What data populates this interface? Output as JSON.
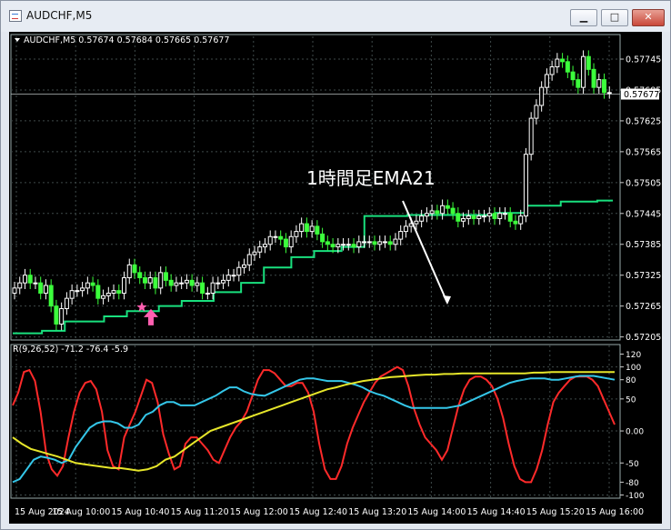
{
  "window": {
    "title": "AUDCHF,M5",
    "buttons": {
      "minimize": "▁",
      "maximize": "□",
      "close": "✕"
    }
  },
  "chart_data": [
    {
      "type": "candlestick",
      "header": "AUDCHF,M5  0.57674 0.57684 0.57665 0.57677",
      "current_price_label": "0.57677",
      "current_price": 0.57677,
      "y_ticks": [
        "0.57745",
        "0.57685",
        "0.57625",
        "0.57565",
        "0.57505",
        "0.57445",
        "0.57385",
        "0.57325",
        "0.57265",
        "0.57205"
      ],
      "ylim": [
        0.57199,
        0.57768
      ],
      "grid": true,
      "annotation": "1時間足EMA21",
      "colors": {
        "bull": "#ffffff",
        "bear": "#3cff3c",
        "ema": "#19e07e",
        "arrow": "#ff5fb0",
        "grid": "#3f4a4a"
      },
      "candle_closes": [
        0.573,
        0.5731,
        0.57325,
        0.5731,
        0.5731,
        0.5729,
        0.57305,
        0.57265,
        0.5723,
        0.5726,
        0.5728,
        0.57295,
        0.57295,
        0.573,
        0.5731,
        0.57305,
        0.5728,
        0.57285,
        0.5729,
        0.57295,
        0.5729,
        0.5732,
        0.57345,
        0.5733,
        0.5732,
        0.5731,
        0.5732,
        0.573,
        0.5733,
        0.57315,
        0.57305,
        0.5731,
        0.5731,
        0.57315,
        0.57305,
        0.5731,
        0.5729,
        0.5729,
        0.5731,
        0.5731,
        0.57315,
        0.57325,
        0.57325,
        0.5734,
        0.57345,
        0.57365,
        0.5737,
        0.5738,
        0.57385,
        0.574,
        0.574,
        0.57395,
        0.5738,
        0.574,
        0.5741,
        0.57425,
        0.5741,
        0.5742,
        0.57405,
        0.5739,
        0.57385,
        0.5738,
        0.57385,
        0.57385,
        0.57385,
        0.5738,
        0.5739,
        0.5739,
        0.5739,
        0.57385,
        0.5739,
        0.5739,
        0.57385,
        0.57395,
        0.5741,
        0.5742,
        0.57425,
        0.5743,
        0.5744,
        0.57445,
        0.5745,
        0.57445,
        0.5746,
        0.57455,
        0.57445,
        0.5743,
        0.57435,
        0.5744,
        0.57435,
        0.5744,
        0.5744,
        0.57445,
        0.57435,
        0.57445,
        0.57445,
        0.5743,
        0.57425,
        0.5744,
        0.5756,
        0.5763,
        0.57655,
        0.5769,
        0.57715,
        0.5773,
        0.57745,
        0.5774,
        0.5772,
        0.57705,
        0.5769,
        0.5775,
        0.57725,
        0.5769,
        0.57705,
        0.5768,
        0.5768
      ],
      "ema_steps": [
        {
          "from": 0,
          "to": 32,
          "value": 0.57212
        },
        {
          "from": 32,
          "to": 57,
          "value": 0.57217
        },
        {
          "from": 57,
          "to": 100,
          "value": 0.57235
        },
        {
          "from": 100,
          "to": 125,
          "value": 0.57245
        },
        {
          "from": 125,
          "to": 160,
          "value": 0.57255
        },
        {
          "from": 160,
          "to": 185,
          "value": 0.57265
        },
        {
          "from": 185,
          "to": 220,
          "value": 0.57275
        },
        {
          "from": 220,
          "to": 250,
          "value": 0.57292
        },
        {
          "from": 250,
          "to": 275,
          "value": 0.5731
        },
        {
          "from": 275,
          "to": 305,
          "value": 0.5734
        },
        {
          "from": 305,
          "to": 330,
          "value": 0.5736
        },
        {
          "from": 330,
          "to": 360,
          "value": 0.57372
        },
        {
          "from": 360,
          "to": 385,
          "value": 0.5738
        },
        {
          "from": 385,
          "to": 432,
          "value": 0.5744
        },
        {
          "from": 432,
          "to": 528,
          "value": 0.57442
        },
        {
          "from": 528,
          "to": 562,
          "value": 0.57446
        },
        {
          "from": 562,
          "to": 600,
          "value": 0.5746
        },
        {
          "from": 600,
          "to": 640,
          "value": 0.57468
        },
        {
          "from": 640,
          "to": 657,
          "value": 0.5747
        }
      ]
    },
    {
      "type": "line",
      "header": "R(9,26,52) -71.2 -76.4 -5.9",
      "y_ticks": [
        "120",
        "100",
        "80",
        "50",
        "0.00",
        "-50",
        "-80",
        "-100"
      ],
      "tick_values": [
        120,
        100,
        80,
        50,
        0,
        -50,
        -80,
        -100
      ],
      "ylim": [
        -105,
        125
      ],
      "x_ticks": [
        "15 Aug 2024",
        "15 Aug 10:00",
        "15 Aug 10:40",
        "15 Aug 11:20",
        "15 Aug 12:00",
        "15 Aug 12:40",
        "15 Aug 13:20",
        "15 Aug 14:00",
        "15 Aug 14:40",
        "15 Aug 15:20",
        "15 Aug 16:00"
      ],
      "series": [
        {
          "color": "#ff2a2a",
          "values": [
            40,
            60,
            92,
            95,
            78,
            30,
            -35,
            -60,
            -70,
            -55,
            -10,
            30,
            60,
            75,
            78,
            65,
            30,
            -30,
            -55,
            -60,
            -10,
            10,
            30,
            55,
            80,
            75,
            45,
            -5,
            -35,
            -60,
            -55,
            -20,
            -10,
            -10,
            -20,
            -30,
            -45,
            -50,
            -30,
            -10,
            5,
            15,
            30,
            55,
            80,
            95,
            95,
            90,
            80,
            70,
            70,
            75,
            75,
            60,
            30,
            -20,
            -60,
            -75,
            -75,
            -55,
            -20,
            5,
            25,
            45,
            60,
            75,
            85,
            90,
            95,
            100,
            95,
            70,
            35,
            10,
            -10,
            -20,
            -30,
            -45,
            -30,
            5,
            40,
            65,
            80,
            85,
            85,
            80,
            70,
            50,
            20,
            -20,
            -55,
            -75,
            -80,
            -80,
            -60,
            -30,
            10,
            45,
            60,
            70,
            80,
            85,
            85,
            85,
            80,
            70,
            50,
            30,
            10
          ]
        },
        {
          "color": "#34c6e8",
          "values": [
            -80,
            -75,
            -60,
            -45,
            -40,
            -42,
            -45,
            -50,
            -45,
            -25,
            -10,
            5,
            12,
            15,
            15,
            12,
            5,
            5,
            10,
            25,
            30,
            40,
            45,
            45,
            40,
            40,
            40,
            45,
            50,
            55,
            62,
            68,
            68,
            62,
            58,
            56,
            55,
            60,
            65,
            70,
            75,
            80,
            82,
            82,
            80,
            78,
            78,
            78,
            75,
            72,
            68,
            62,
            58,
            55,
            50,
            45,
            40,
            36,
            36,
            36,
            36,
            36,
            36,
            38,
            40,
            45,
            50,
            55,
            60,
            65,
            70,
            75,
            78,
            80,
            82,
            82,
            82,
            80,
            80,
            82,
            84,
            86,
            86,
            86,
            84,
            82,
            80
          ]
        },
        {
          "color": "#e6e62a",
          "values": [
            -10,
            -20,
            -28,
            -32,
            -36,
            -40,
            -45,
            -50,
            -52,
            -54,
            -56,
            -58,
            -58,
            -60,
            -62,
            -60,
            -55,
            -45,
            -40,
            -30,
            -20,
            -10,
            0,
            5,
            10,
            15,
            20,
            25,
            30,
            35,
            40,
            45,
            50,
            55,
            60,
            65,
            68,
            72,
            75,
            78,
            80,
            82,
            84,
            85,
            86,
            87,
            88,
            88,
            89,
            89,
            90,
            90,
            90,
            90,
            90,
            90,
            90,
            90,
            91,
            91,
            92,
            92,
            92,
            92,
            92,
            92,
            92,
            92
          ]
        }
      ]
    }
  ]
}
